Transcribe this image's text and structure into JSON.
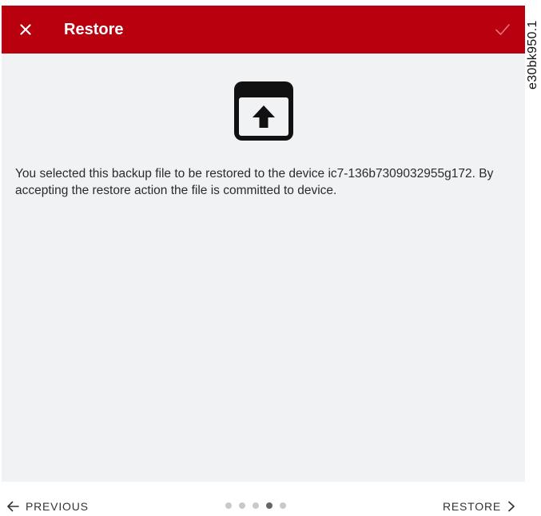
{
  "header": {
    "close_icon": "close-icon",
    "title": "Restore",
    "confirm_icon": "checkmark-icon",
    "background_color": "#b8000f"
  },
  "content": {
    "icon": "archive-upload-icon",
    "message": "You selected this backup file to be restored to the device ic7-136b7309032955g172. By accepting the restore action the file is committed to device."
  },
  "side_code": "e30bk950.1",
  "footer": {
    "previous_label": "PREVIOUS",
    "restore_label": "RESTORE",
    "pager": {
      "total": 5,
      "active_index": 3
    }
  }
}
